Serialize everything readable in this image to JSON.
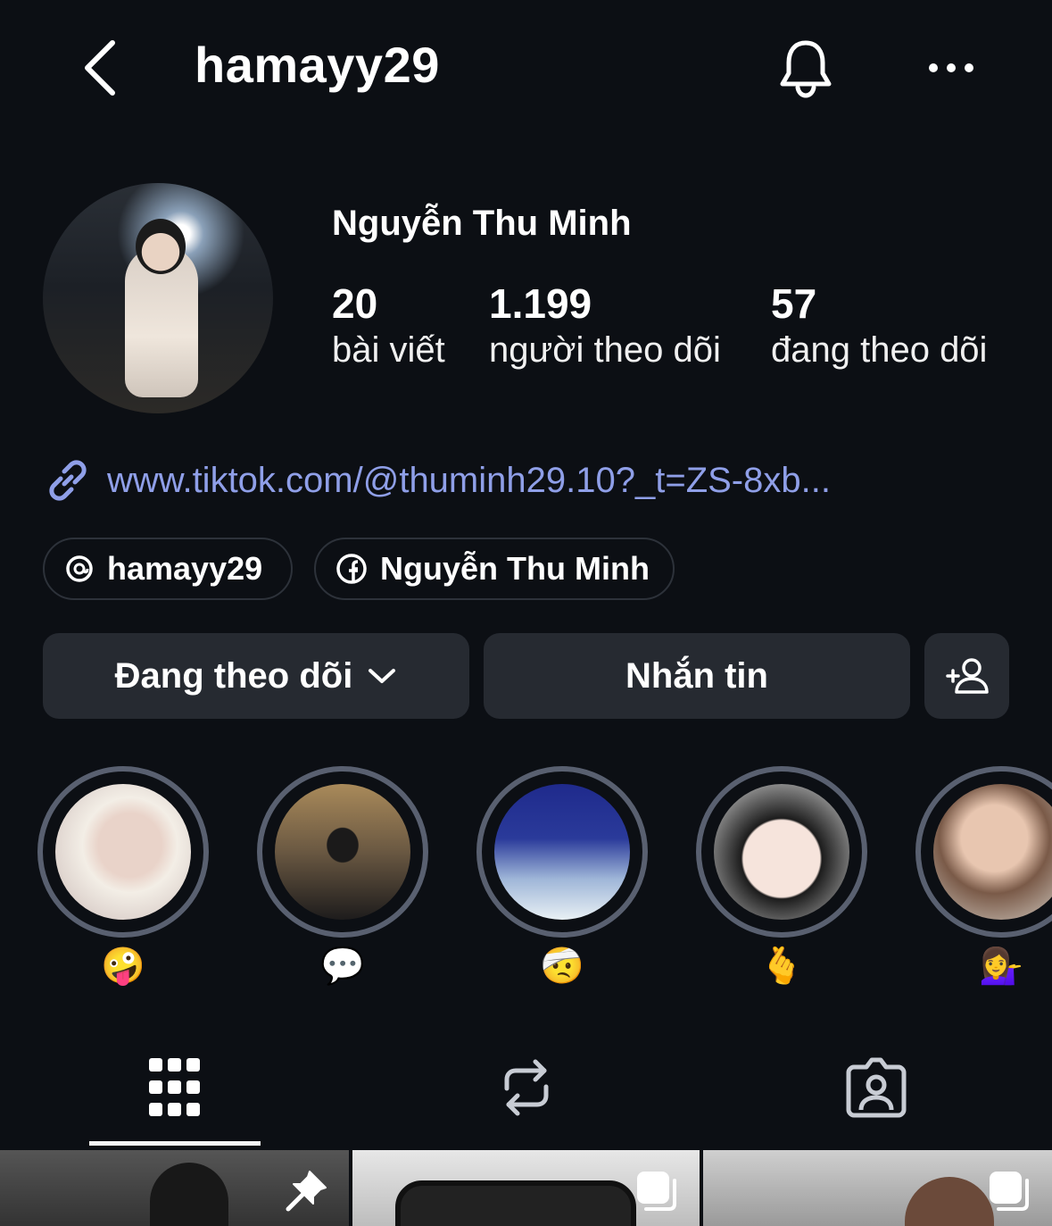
{
  "header": {
    "username": "hamayy29",
    "icons": {
      "back": "chevron-left-icon",
      "notifications": "bell-icon",
      "more": "more-horizontal-icon"
    }
  },
  "profile": {
    "full_name": "Nguyễn Thu Minh",
    "stats": {
      "posts": {
        "count": "20",
        "label": "bài viết"
      },
      "followers": {
        "count": "1.199",
        "label": "người theo dõi"
      },
      "following": {
        "count": "57",
        "label": "đang theo dõi"
      }
    },
    "link": "www.tiktok.com/@thuminh29.10?_t=ZS-8xb...",
    "pills": {
      "threads": "hamayy29",
      "facebook": "Nguyễn Thu Minh"
    }
  },
  "actions": {
    "following_label": "Đang theo dõi",
    "message_label": "Nhắn tin"
  },
  "highlights": [
    {
      "emoji": "🤪"
    },
    {
      "emoji": "💬"
    },
    {
      "emoji": "🤕"
    },
    {
      "emoji": "🫰"
    },
    {
      "emoji": "💁‍♀️"
    }
  ],
  "tabs": [
    "grid-icon",
    "repost-icon",
    "tagged-icon"
  ],
  "colors": {
    "background": "#0c0f14",
    "button": "#262a31",
    "link": "#8f9fe8",
    "ring": "#596070"
  }
}
